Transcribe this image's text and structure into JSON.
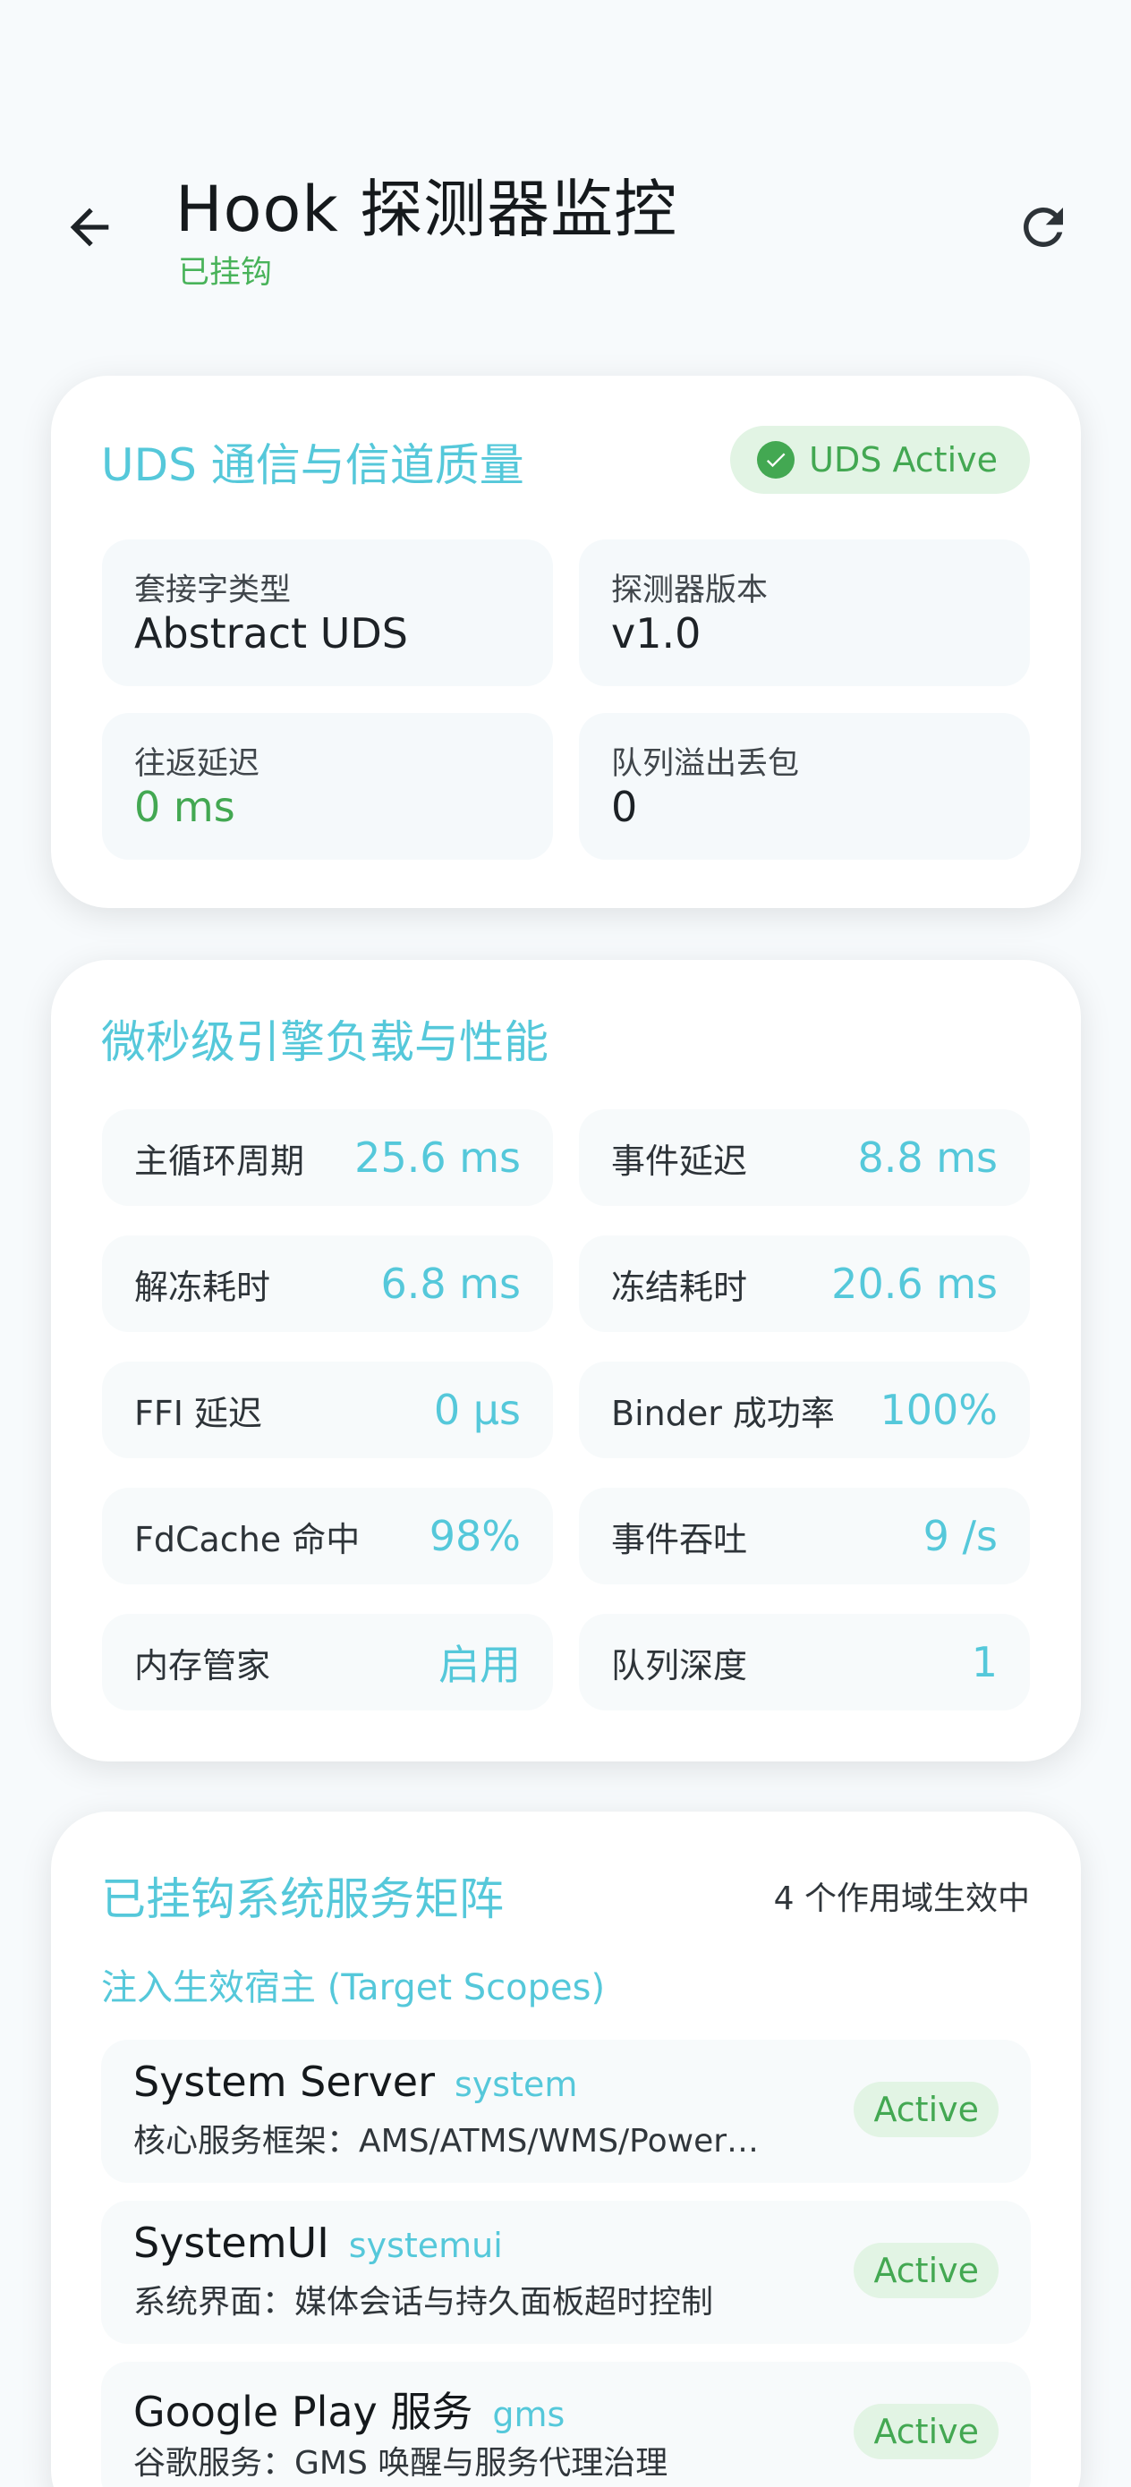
{
  "header": {
    "title": "Hook 探测器监控",
    "subtitle": "已挂钩",
    "back_icon": "arrow-left-icon",
    "refresh_icon": "refresh-icon"
  },
  "uds_card": {
    "title": "UDS 通信与信道质量",
    "badge": "UDS Active",
    "fields": [
      {
        "label": "套接字类型",
        "value": "Abstract UDS"
      },
      {
        "label": "探测器版本",
        "value": "v1.0"
      },
      {
        "label": "往返延迟",
        "value": "0 ms"
      },
      {
        "label": "队列溢出丢包",
        "value": "0"
      }
    ]
  },
  "perf_card": {
    "title": "微秒级引擎负载与性能",
    "metrics": [
      {
        "label": "主循环周期",
        "value": "25.6 ms"
      },
      {
        "label": "事件延迟",
        "value": "8.8 ms"
      },
      {
        "label": "解冻耗时",
        "value": "6.8 ms"
      },
      {
        "label": "冻结耗时",
        "value": "20.6 ms"
      },
      {
        "label": "FFI 延迟",
        "value": "0 µs"
      },
      {
        "label": "Binder 成功率",
        "value": "100%"
      },
      {
        "label": "FdCache 命中",
        "value": "98%"
      },
      {
        "label": "事件吞吐",
        "value": "9 /s"
      },
      {
        "label": "内存管家",
        "value": "启用"
      },
      {
        "label": "队列深度",
        "value": "1"
      }
    ]
  },
  "services_card": {
    "title": "已挂钩系统服务矩阵",
    "scope_count": "4 个作用域生效中",
    "section_label": "注入生效宿主 (Target Scopes)",
    "services": [
      {
        "name": "System Server",
        "package": "system",
        "desc": "核心服务框架：AMS/ATMS/WMS/Power…",
        "status": "Active"
      },
      {
        "name": "SystemUI",
        "package": "systemui",
        "desc": "系统界面：媒体会话与持久面板超时控制",
        "status": "Active"
      },
      {
        "name": "Google Play 服务",
        "package": "gms",
        "desc": "谷歌服务：GMS 唤醒与服务代理治理",
        "status": "Active"
      }
    ]
  },
  "colors": {
    "accent": "#55c8da",
    "success": "#43a852",
    "success_bg": "#e2f4e4",
    "background": "#f7fafc"
  }
}
